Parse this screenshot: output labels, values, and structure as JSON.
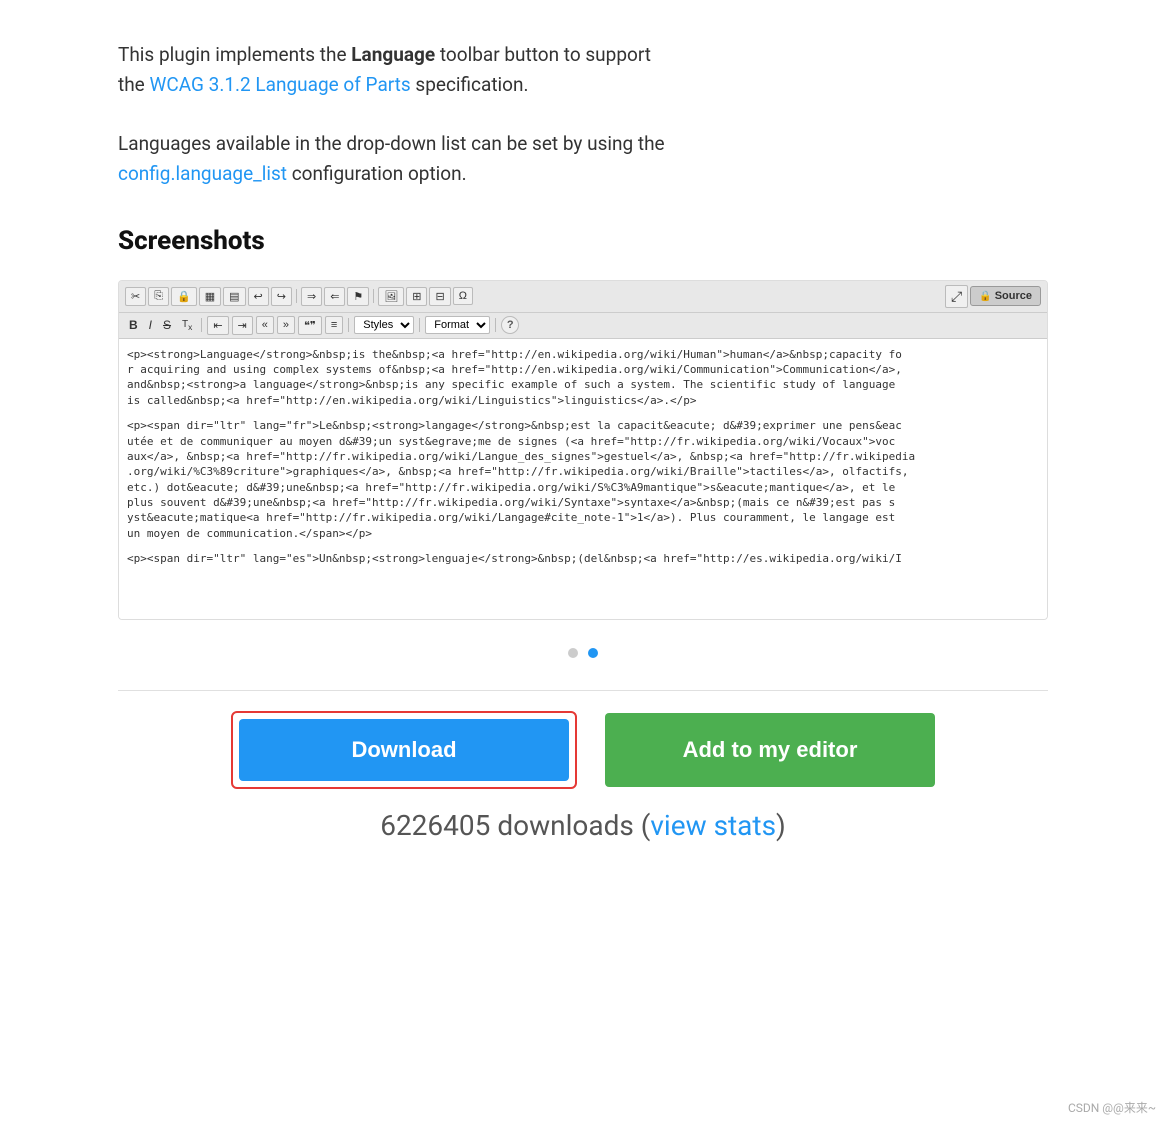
{
  "description": {
    "line1_pre": "This plugin implements the ",
    "line1_bold": "Language",
    "line1_post": " toolbar button to support",
    "line2_pre": "the ",
    "line2_link": "WCAG 3.1.2 Language of Parts",
    "line2_post": " specification.",
    "line3": "Languages available in the drop-down list can be set by using the",
    "line4_link": "config.language_list",
    "line4_post": " configuration option."
  },
  "screenshots": {
    "title": "Screenshots",
    "content_lines": [
      "<p><strong>Language</strong>&nbsp;is the&nbsp;<a href=\"http://en.wikipedia.org/wiki/Human\">human</a>&nbsp;capacity for acquiring and using complex systems of&nbsp;<a href=\"http://en.wikipedia.org/wiki/Communication\">Communication</a>, and&nbsp;<strong>a language</strong>&nbsp;is any specific example of such a system. The scientific study of language is called&nbsp;<a href=\"http://en.wikipedia.org/wiki/Linguistics\">linguistics</a>.</p>",
      "<p><span dir=\"ltr\" lang=\"fr\">Le&nbsp;<strong>langage</strong>&nbsp;est la capacit&eacute; d&#39;exprimer une pens&eacute;e et de communiquer au moyen d&#39;un syst&egrave;me de signes (<a href=\"http://fr.wikipedia.org/wiki/Vocaux\">vocaux</a>, &nbsp;<a href=\"http://fr.wikipedia.org/wiki/Langue_des_signes\">gestuel</a>, &nbsp;<a href=\"http://fr.wikipedia.org/wiki/%C3%89criture\">graphiques</a>, &nbsp;<a href=\"http://fr.wikipedia.org/wiki/Braille\">tactiles</a>, olfactifs, etc.) dot&eacute;e d&#39;une&nbsp;<a href=\"http://fr.wikipedia.org/wiki/S%C3%A9mantique\">&eacute;mantique</a>, et le plus souvent d&#39;une&nbsp;<a href=\"http://fr.wikipedia.org/wiki/Syntaxe\">syntaxe</a>&nbsp;(mais ce n&#39;est pas s yst&eacute;matique<a href=\"http://fr.wikipedia.org/wiki/Langage#cite_note-1\">1</a>). Plus couramment, le langage est un moyen de communication.</span></p>",
      "<p><span dir=\"ltr\" lang=\"es\">Un&nbsp;<strong>lenguaje</strong>&nbsp;(del&nbsp;<a href=\"http://es.wikipedia.org/wiki/I"
    ],
    "pagination_dots": [
      {
        "active": false
      },
      {
        "active": true
      }
    ]
  },
  "actions": {
    "download_label": "Download",
    "add_editor_label": "Add to my editor"
  },
  "stats": {
    "downloads_count": "6226405",
    "downloads_label": "downloads",
    "view_stats_link": "view stats"
  },
  "watermark": "CSDN @@来来~"
}
